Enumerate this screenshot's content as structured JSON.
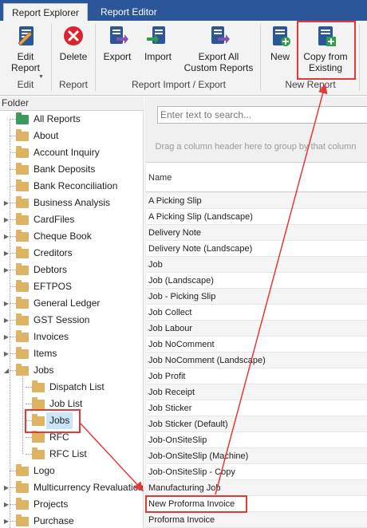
{
  "tabs": [
    {
      "label": "Report Explorer",
      "active": true
    },
    {
      "label": "Report Editor",
      "active": false
    }
  ],
  "ribbon": {
    "buttons": {
      "edit_report": "Edit\nReport",
      "delete": "Delete",
      "export": "Export",
      "import": "Import",
      "export_all": "Export All\nCustom Reports",
      "new": "New",
      "copy_from_existing": "Copy from\nExisting"
    },
    "groups": {
      "edit": "Edit",
      "report": "Report",
      "import_export": "Report Import / Export",
      "new_report": "New Report"
    }
  },
  "folder_pane": {
    "header": "Folder",
    "items": [
      {
        "label": "All Reports",
        "icon": "reports-folder-icon",
        "expander": false
      },
      {
        "label": "About",
        "icon": "folder-icon",
        "expander": false
      },
      {
        "label": "Account Inquiry",
        "icon": "folder-icon",
        "expander": false
      },
      {
        "label": "Bank Deposits",
        "icon": "folder-icon",
        "expander": false
      },
      {
        "label": "Bank Reconciliation",
        "icon": "folder-icon",
        "expander": false
      },
      {
        "label": "Business Analysis",
        "icon": "folder-icon",
        "expander": true
      },
      {
        "label": "CardFiles",
        "icon": "folder-icon",
        "expander": true
      },
      {
        "label": "Cheque Book",
        "icon": "folder-icon",
        "expander": true
      },
      {
        "label": "Creditors",
        "icon": "folder-icon",
        "expander": true
      },
      {
        "label": "Debtors",
        "icon": "folder-icon",
        "expander": true
      },
      {
        "label": "EFTPOS",
        "icon": "folder-icon",
        "expander": false
      },
      {
        "label": "General Ledger",
        "icon": "folder-icon",
        "expander": true
      },
      {
        "label": "GST Session",
        "icon": "folder-icon",
        "expander": true
      },
      {
        "label": "Invoices",
        "icon": "folder-icon",
        "expander": true
      },
      {
        "label": "Items",
        "icon": "folder-icon",
        "expander": true
      },
      {
        "label": "Jobs",
        "icon": "folder-icon",
        "expander": true,
        "expanded": true
      },
      {
        "label": "Dispatch List",
        "icon": "folder-icon",
        "child": true
      },
      {
        "label": "Job List",
        "icon": "folder-icon",
        "child": true
      },
      {
        "label": "Jobs",
        "icon": "folder-icon",
        "child": true,
        "selected": true
      },
      {
        "label": "RFC",
        "icon": "folder-icon",
        "child": true
      },
      {
        "label": "RFC List",
        "icon": "folder-icon",
        "child": true
      },
      {
        "label": "Logo",
        "icon": "folder-icon",
        "expander": false
      },
      {
        "label": "Multicurrency Revaluation",
        "icon": "folder-icon",
        "expander": true
      },
      {
        "label": "Projects",
        "icon": "folder-icon",
        "expander": true
      },
      {
        "label": "Purchase",
        "icon": "folder-icon",
        "expander": true
      }
    ]
  },
  "grid": {
    "search_placeholder": "Enter text to search...",
    "group_hint": "Drag a column header here to group by that column",
    "column_header": "Name",
    "rows": [
      "A Picking Slip",
      "A Picking Slip (Landscape)",
      "Delivery Note",
      "Delivery Note (Landscape)",
      "Job",
      "Job (Landscape)",
      "Job - Picking Slip",
      "Job Collect",
      "Job Labour",
      "Job NoComment",
      "Job NoComment (Landscape)",
      "Job Profit",
      "Job Receipt",
      "Job Sticker",
      "Job Sticker (Default)",
      "Job-OnSiteSlip",
      "Job-OnSiteSlip (Machine)",
      "Job-OnSiteSlip - Copy",
      "Manufacturing Job",
      "New Proforma Invoice",
      "Proforma Invoice"
    ]
  },
  "colors": {
    "tab_bar": "#2b579a",
    "highlight": "#e53935",
    "folder": "#dcb464",
    "selection": "#cce4f7"
  }
}
